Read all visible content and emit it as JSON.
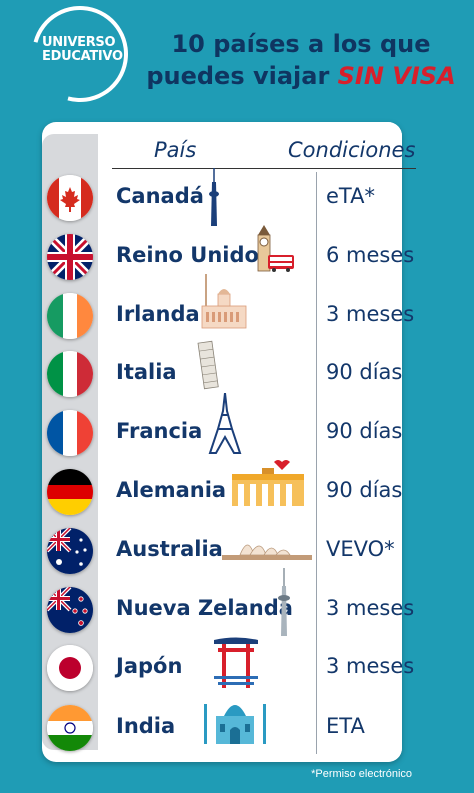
{
  "logo": {
    "line1": "UNIVERSO",
    "line2": "EDUCATIVO"
  },
  "title": {
    "line1": "10 países a los que",
    "line2_prefix": "puedes viajar",
    "line2_accent": "SIN VISA"
  },
  "table": {
    "header_country": "País",
    "header_conditions": "Condiciones",
    "rows": [
      {
        "country": "Canadá",
        "condition": "eTA*",
        "flag": "canada-flag-icon",
        "landmark": "cn-tower-icon"
      },
      {
        "country": "Reino Unido",
        "condition": "6 meses",
        "flag": "uk-flag-icon",
        "landmark": "big-ben-bus-icon"
      },
      {
        "country": "Irlanda",
        "condition": "3 meses",
        "flag": "ireland-flag-icon",
        "landmark": "dublin-building-icon"
      },
      {
        "country": "Italia",
        "condition": "90 días",
        "flag": "italy-flag-icon",
        "landmark": "pisa-tower-icon"
      },
      {
        "country": "Francia",
        "condition": "90 días",
        "flag": "france-flag-icon",
        "landmark": "eiffel-tower-icon"
      },
      {
        "country": "Alemania",
        "condition": "90 días",
        "flag": "germany-flag-icon",
        "landmark": "brandenburg-gate-icon"
      },
      {
        "country": "Australia",
        "condition": "VEVO*",
        "flag": "australia-flag-icon",
        "landmark": "sydney-opera-icon"
      },
      {
        "country": "Nueva Zelanda",
        "condition": "3 meses",
        "flag": "new-zealand-flag-icon",
        "landmark": "sky-tower-icon"
      },
      {
        "country": "Japón",
        "condition": "3 meses",
        "flag": "japan-flag-icon",
        "landmark": "torii-gate-icon"
      },
      {
        "country": "India",
        "condition": "ETA",
        "flag": "india-flag-icon",
        "landmark": "taj-mahal-icon"
      }
    ]
  },
  "footnote": "*Permiso electrónico",
  "colors": {
    "background": "#1f9cb5",
    "navy": "#13376a",
    "accent_red": "#d81f2b"
  }
}
